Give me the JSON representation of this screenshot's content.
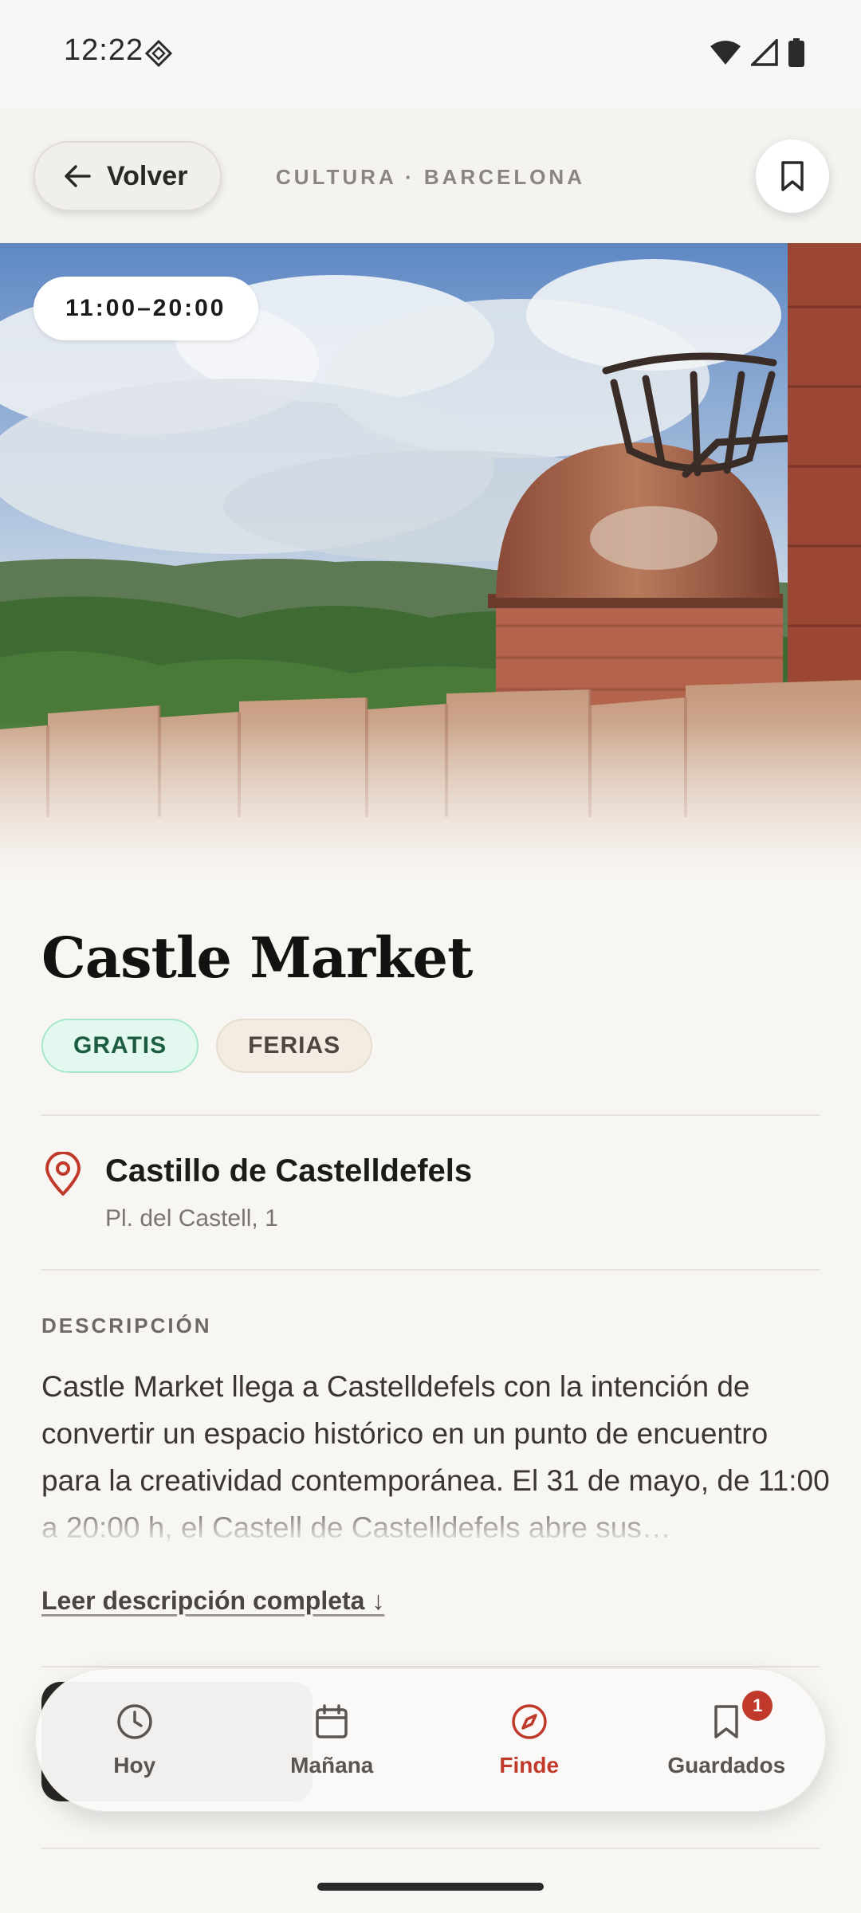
{
  "status_bar": {
    "time": "12:22"
  },
  "header": {
    "back_label": "Volver",
    "breadcrumb": "CULTURA · BARCELONA"
  },
  "hero": {
    "hours": "11:00–20:00"
  },
  "event": {
    "title": "Castle Market",
    "tags": [
      "GRATIS",
      "FERIAS"
    ],
    "venue_name": "Castillo de Castelldefels",
    "venue_address": "Pl. del Castell, 1",
    "description_label": "DESCRIPCIÓN",
    "description": "Castle Market llega a Castelldefels con la intención de convertir un espacio histórico en un punto de encuentro para la creatividad contemporánea. El 31 de mayo, de 11:00 a 20:00 h, el Castell de Castelldefels abre sus…",
    "read_more": "Leer descripción completa ↓"
  },
  "bottom_nav": {
    "items": [
      {
        "label": "Hoy",
        "icon": "clock-icon",
        "active": false
      },
      {
        "label": "Mañana",
        "icon": "calendar-icon",
        "active": false
      },
      {
        "label": "Finde",
        "icon": "compass-icon",
        "active": true
      },
      {
        "label": "Guardados",
        "icon": "bookmark-icon",
        "active": false,
        "badge": "1"
      }
    ]
  },
  "colors": {
    "accent": "#c0392b",
    "free_tag_bg": "#e3f8ef",
    "free_tag_text": "#1c5c41",
    "background": "#f8f6f3"
  }
}
